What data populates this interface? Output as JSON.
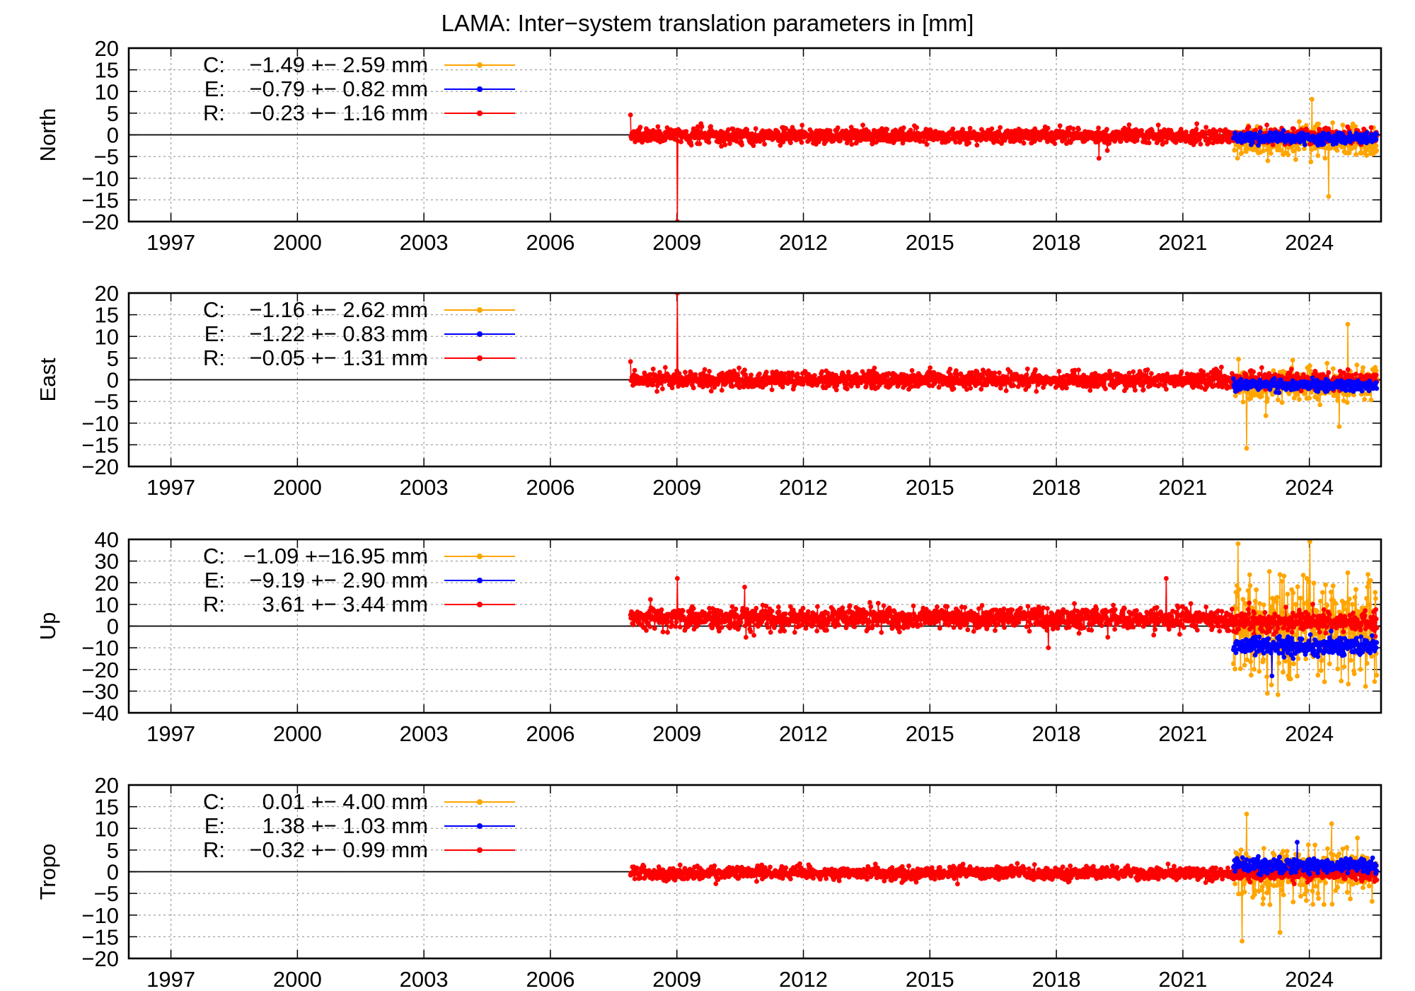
{
  "title": "LAMA: Inter−system translation parameters in [mm]",
  "colors": {
    "C": "#ffa500",
    "E": "#0000ff",
    "R": "#ff0000",
    "grid": "#a0a0a0",
    "axis": "#000000"
  },
  "chart_data": [
    {
      "type": "line",
      "ylabel": "North",
      "ylim": [
        -20,
        20
      ],
      "yticks": [
        "20",
        "15",
        "10",
        "5",
        "0",
        "−5",
        "−10",
        "−15",
        "−20"
      ],
      "xticks": [
        "1997",
        "2000",
        "2003",
        "2006",
        "2009",
        "2012",
        "2015",
        "2018",
        "2021",
        "2024"
      ],
      "xlim": [
        1996,
        2025.7
      ],
      "grid": true,
      "legend_position": "top-left",
      "series": [
        {
          "name": "C",
          "label": "C:",
          "stats": "−1.49 +− 2.59 mm",
          "mean": -1.49,
          "sd": 2.59,
          "start": 2022.2,
          "end": 2025.6,
          "spikes": [
            {
              "x": 2024.05,
              "y": 8.2
            },
            {
              "x": 2024.45,
              "y": -14.2
            }
          ]
        },
        {
          "name": "E",
          "label": "E:",
          "stats": "−0.79 +− 0.82 mm",
          "mean": -0.79,
          "sd": 0.82,
          "start": 2022.2,
          "end": 2025.6,
          "spikes": []
        },
        {
          "name": "R",
          "label": "R:",
          "stats": "−0.23 +− 1.16 mm",
          "mean": -0.23,
          "sd": 1.16,
          "start": 2007.9,
          "end": 2025.6,
          "spikes": [
            {
              "x": 2009.0,
              "y": -20
            },
            {
              "x": 2007.9,
              "y": 4.6
            },
            {
              "x": 2019.0,
              "y": -5.4
            }
          ]
        }
      ]
    },
    {
      "type": "line",
      "ylabel": "East",
      "ylim": [
        -20,
        20
      ],
      "yticks": [
        "20",
        "15",
        "10",
        "5",
        "0",
        "−5",
        "−10",
        "−15",
        "−20"
      ],
      "xticks": [
        "1997",
        "2000",
        "2003",
        "2006",
        "2009",
        "2012",
        "2015",
        "2018",
        "2021",
        "2024"
      ],
      "xlim": [
        1996,
        2025.7
      ],
      "grid": true,
      "legend_position": "top-left",
      "series": [
        {
          "name": "C",
          "label": "C:",
          "stats": "−1.16 +− 2.62 mm",
          "mean": -1.16,
          "sd": 2.62,
          "start": 2022.2,
          "end": 2025.6,
          "spikes": [
            {
              "x": 2024.9,
              "y": 12.8
            },
            {
              "x": 2022.5,
              "y": -15.8
            },
            {
              "x": 2024.7,
              "y": -10.8
            }
          ]
        },
        {
          "name": "E",
          "label": "E:",
          "stats": "−1.22 +− 0.83 mm",
          "mean": -1.22,
          "sd": 0.83,
          "start": 2022.2,
          "end": 2025.6,
          "spikes": []
        },
        {
          "name": "R",
          "label": "R:",
          "stats": "−0.05 +− 1.31 mm",
          "mean": -0.05,
          "sd": 1.31,
          "start": 2007.9,
          "end": 2025.6,
          "spikes": [
            {
              "x": 2009.0,
              "y": 20
            },
            {
              "x": 2007.9,
              "y": 4.2
            }
          ]
        }
      ]
    },
    {
      "type": "line",
      "ylabel": "Up",
      "ylim": [
        -40,
        40
      ],
      "yticks": [
        "40",
        "30",
        "20",
        "10",
        "0",
        "−10",
        "−20",
        "−30",
        "−40"
      ],
      "xticks": [
        "1997",
        "2000",
        "2003",
        "2006",
        "2009",
        "2012",
        "2015",
        "2018",
        "2021",
        "2024"
      ],
      "xlim": [
        1996,
        2025.7
      ],
      "grid": true,
      "legend_position": "top-left",
      "series": [
        {
          "name": "C",
          "label": "C:",
          "stats": "−1.09 +−16.95 mm",
          "mean": -1.09,
          "sd": 16.95,
          "start": 2022.2,
          "end": 2025.6,
          "spikes": [
            {
              "x": 2022.3,
              "y": 38
            },
            {
              "x": 2024.0,
              "y": 39
            }
          ]
        },
        {
          "name": "E",
          "label": "E:",
          "stats": "−9.19 +− 2.90 mm",
          "mean": -9.19,
          "sd": 2.9,
          "start": 2022.2,
          "end": 2025.6,
          "spikes": [
            {
              "x": 2023.1,
              "y": -23
            }
          ]
        },
        {
          "name": "R",
          "label": "R:",
          "stats": "3.61 +− 3.44 mm",
          "mean": 3.61,
          "sd": 3.44,
          "start": 2007.9,
          "end": 2025.6,
          "spikes": [
            {
              "x": 2009.0,
              "y": 22
            },
            {
              "x": 2010.6,
              "y": 18
            },
            {
              "x": 2020.6,
              "y": 22
            },
            {
              "x": 2017.8,
              "y": -10
            }
          ]
        }
      ]
    },
    {
      "type": "line",
      "ylabel": "Tropo",
      "ylim": [
        -20,
        20
      ],
      "yticks": [
        "20",
        "15",
        "10",
        "5",
        "0",
        "−5",
        "−10",
        "−15",
        "−20"
      ],
      "xticks": [
        "1997",
        "2000",
        "2003",
        "2006",
        "2009",
        "2012",
        "2015",
        "2018",
        "2021",
        "2024"
      ],
      "xlim": [
        1996,
        2025.7
      ],
      "grid": true,
      "legend_position": "top-left",
      "series": [
        {
          "name": "C",
          "label": "C:",
          "stats": "0.01 +− 4.00 mm",
          "mean": 0.01,
          "sd": 4.0,
          "start": 2022.2,
          "end": 2025.6,
          "spikes": [
            {
              "x": 2022.5,
              "y": 13.3
            },
            {
              "x": 2022.4,
              "y": -16.0
            },
            {
              "x": 2023.3,
              "y": -14.0
            }
          ]
        },
        {
          "name": "E",
          "label": "E:",
          "stats": "1.38 +− 1.03 mm",
          "mean": 1.38,
          "sd": 1.03,
          "start": 2022.2,
          "end": 2025.6,
          "spikes": [
            {
              "x": 2023.7,
              "y": 6.8
            }
          ]
        },
        {
          "name": "R",
          "label": "R:",
          "stats": "−0.32 +− 0.99 mm",
          "mean": -0.32,
          "sd": 0.99,
          "start": 2007.9,
          "end": 2025.6,
          "spikes": []
        }
      ]
    }
  ]
}
